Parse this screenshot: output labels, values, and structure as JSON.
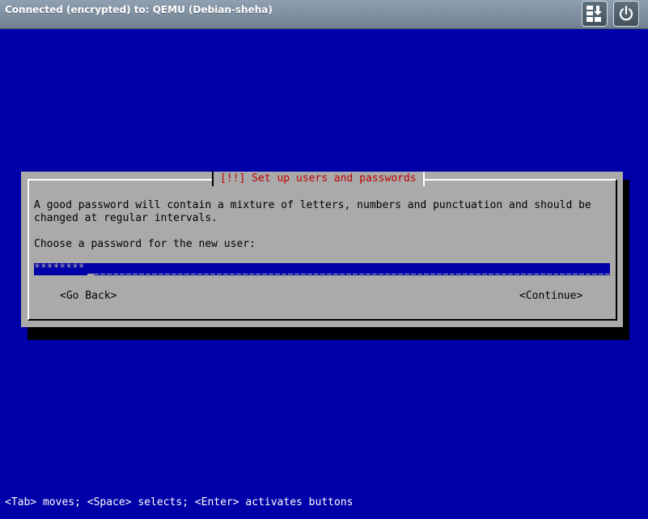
{
  "window": {
    "title": "Connected (encrypted) to: QEMU (Debian-sheha)",
    "buttons": [
      {
        "name": "send-keys",
        "icon": "keyboard-send-keys-icon"
      },
      {
        "name": "power",
        "icon": "power-icon"
      }
    ]
  },
  "dialog": {
    "title": "[!!] Set up users and passwords",
    "description_line1": "A good password will contain a mixture of letters, numbers and punctuation and should be",
    "description_line2": "changed at regular intervals.",
    "prompt": "Choose a password for the new user:",
    "password_value": "********",
    "go_back_label": "<Go Back>",
    "continue_label": "<Continue>"
  },
  "statusbar": {
    "help": "<Tab> moves; <Space> selects; <Enter> activates buttons"
  },
  "colors": {
    "screen_bg": "#0000a8",
    "dialog_bg": "#aaaaaa",
    "title_red": "#c00000"
  }
}
